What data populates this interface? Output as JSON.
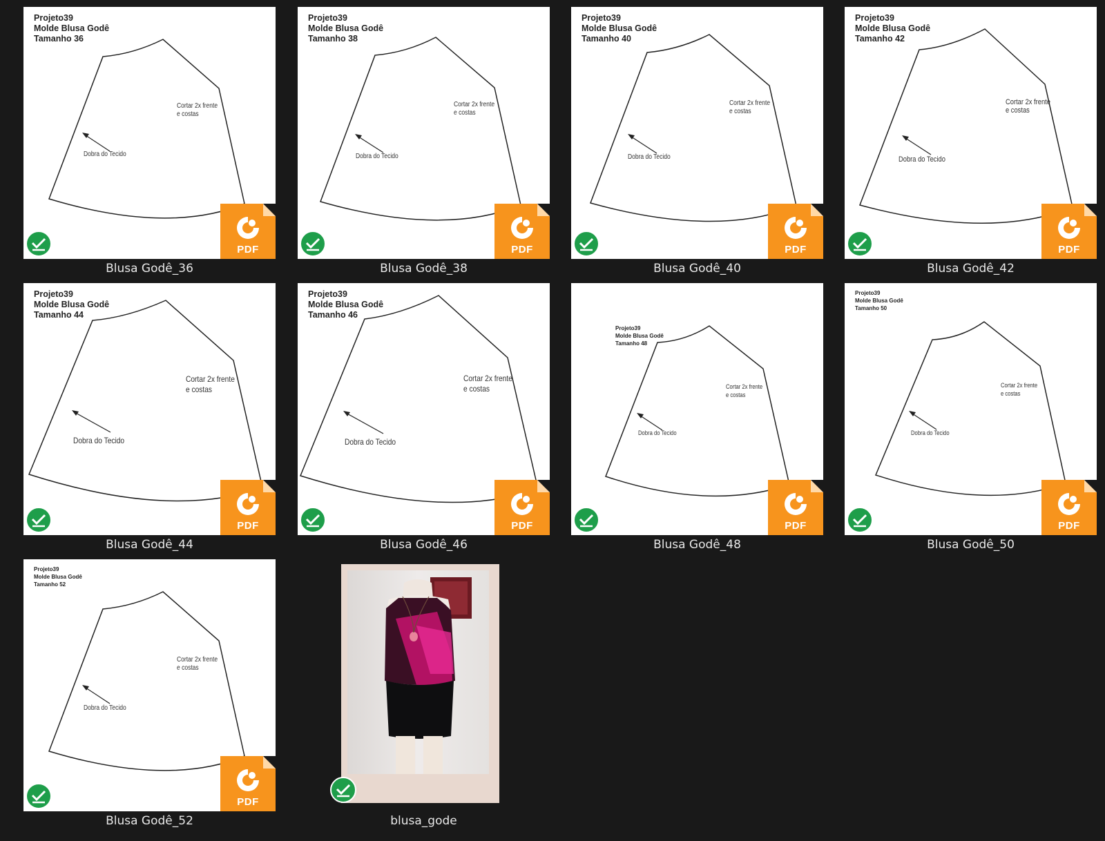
{
  "files": [
    {
      "name": "Blusa Godê_36",
      "project": "Projeto39",
      "mold": "Molde Blusa Godê",
      "size": "Tamanho 36",
      "note1": "Cortar 2x frente",
      "note2": "e costas",
      "fold": "Dobra do Tecido",
      "type": "pdf"
    },
    {
      "name": "Blusa Godê_38",
      "project": "Projeto39",
      "mold": "Molde Blusa Godê",
      "size": "Tamanho 38",
      "note1": "Cortar 2x frente",
      "note2": "e costas",
      "fold": "Dobra do Tecido",
      "type": "pdf"
    },
    {
      "name": "Blusa Godê_40",
      "project": "Projeto39",
      "mold": "Molde Blusa Godê",
      "size": "Tamanho 40",
      "note1": "Cortar 2x frente",
      "note2": "e costas",
      "fold": "Dobra do Tecido",
      "type": "pdf"
    },
    {
      "name": "Blusa Godê_42",
      "project": "Projeto39",
      "mold": "Molde Blusa Godê",
      "size": "Tamanho 42",
      "note1": "Cortar 2x frente",
      "note2": "e costas",
      "fold": "Dobra do Tecido",
      "type": "pdf"
    },
    {
      "name": "Blusa Godê_44",
      "project": "Projeto39",
      "mold": "Molde Blusa Godê",
      "size": "Tamanho 44",
      "note1": "Cortar 2x frente",
      "note2": "e costas",
      "fold": "Dobra do Tecido",
      "type": "pdf"
    },
    {
      "name": "Blusa Godê_46",
      "project": "Projeto39",
      "mold": "Molde Blusa Godê",
      "size": "Tamanho 46",
      "note1": "Cortar 2x frente",
      "note2": "e costas",
      "fold": "Dobra do Tecido",
      "type": "pdf"
    },
    {
      "name": "Blusa Godê_48",
      "project": "Projeto39",
      "mold": "Molde Blusa Godê",
      "size": "Tamanho 48",
      "note1": "Cortar 2x frente",
      "note2": "e costas",
      "fold": "Dobra do Tecido",
      "type": "pdf"
    },
    {
      "name": "Blusa Godê_50",
      "project": "Projeto39",
      "mold": "Molde Blusa Godê",
      "size": "Tamanho 50",
      "note1": "Cortar 2x frente",
      "note2": "e costas",
      "fold": "Dobra do Tecido",
      "type": "pdf"
    },
    {
      "name": "Blusa Godê_52",
      "project": "Projeto39",
      "mold": "Molde Blusa Godê",
      "size": "Tamanho 52",
      "note1": "Cortar 2x frente",
      "note2": "e costas",
      "fold": "Dobra do Tecido",
      "type": "pdf"
    },
    {
      "name": "blusa_gode",
      "type": "image"
    }
  ],
  "badge": {
    "label": "PDF",
    "color": "#f7941d"
  },
  "sync_status": {
    "icon": "green-check-icon",
    "color": "#1e9e4a"
  }
}
